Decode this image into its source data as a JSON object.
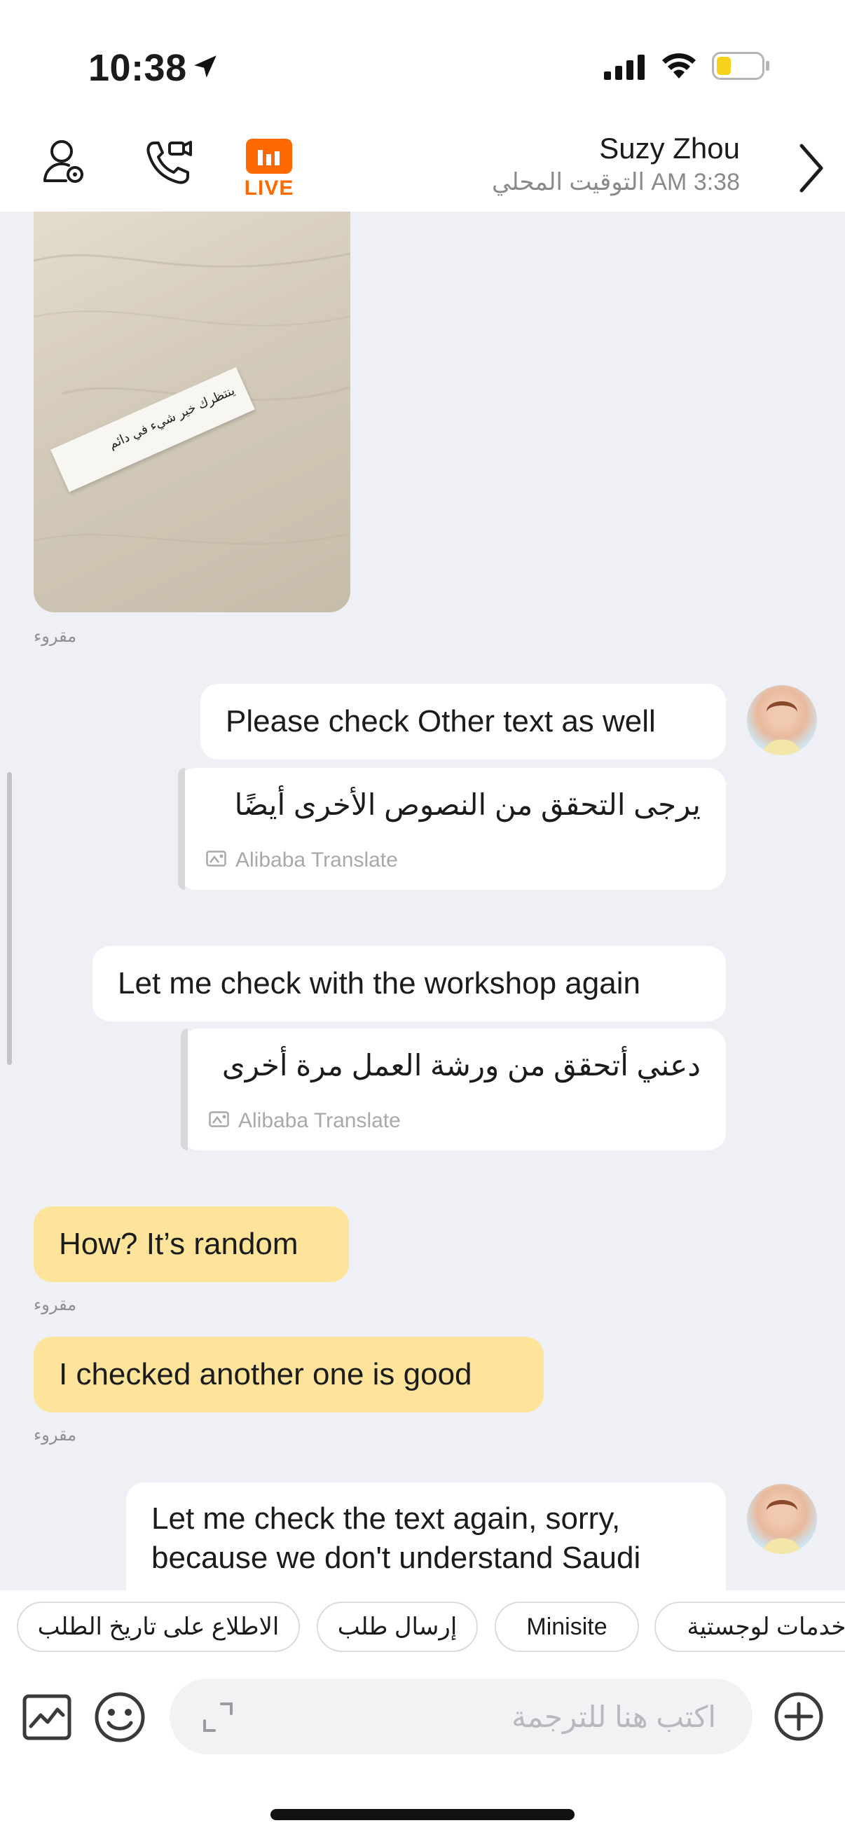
{
  "status_bar": {
    "time": "10:38",
    "icons": [
      "location-arrow-icon",
      "signal-icon",
      "wifi-icon",
      "battery-icon"
    ],
    "battery_color": "#f6d21d"
  },
  "header": {
    "live_label": "LIVE",
    "contact_name": "Suzy Zhou",
    "local_time": "التوقيت المحلي AM 3:38",
    "accent": "#ff6a00",
    "icons": [
      "contact-profile-icon",
      "video-call-icon",
      "live-icon",
      "chevron-right-icon"
    ]
  },
  "photo": {
    "paper_text": "ينتظرك خير شيء في دائم"
  },
  "messages": {
    "read_label": "مقروء",
    "m1_text": "Please check Other text as well",
    "m1_translation": "يرجى التحقق من النصوص الأخرى أيضًا",
    "m2_text": "Let me check with the workshop again",
    "m2_translation": "دعني أتحقق من ورشة العمل مرة أخرى",
    "translation_source": "Alibaba Translate",
    "m3_text": "How? It’s random",
    "m4_text": "I checked another one is good",
    "m5_line1": "Let me check the text again, sorry,",
    "m5_line2": "because we don't understand Saudi"
  },
  "quick_replies": [
    "الاطلاع على تاريخ الطلب",
    "إرسال طلب",
    "Minisite",
    "خدمات لوجستية"
  ],
  "input": {
    "placeholder": "اكتب هنا للترجمة",
    "icons": [
      "image-icon",
      "emoji-icon",
      "expand-icon",
      "add-icon"
    ]
  },
  "colors": {
    "background": "#eff0f5",
    "incoming_bubble": "#fde49a",
    "outgoing_bubble": "#ffffff"
  }
}
